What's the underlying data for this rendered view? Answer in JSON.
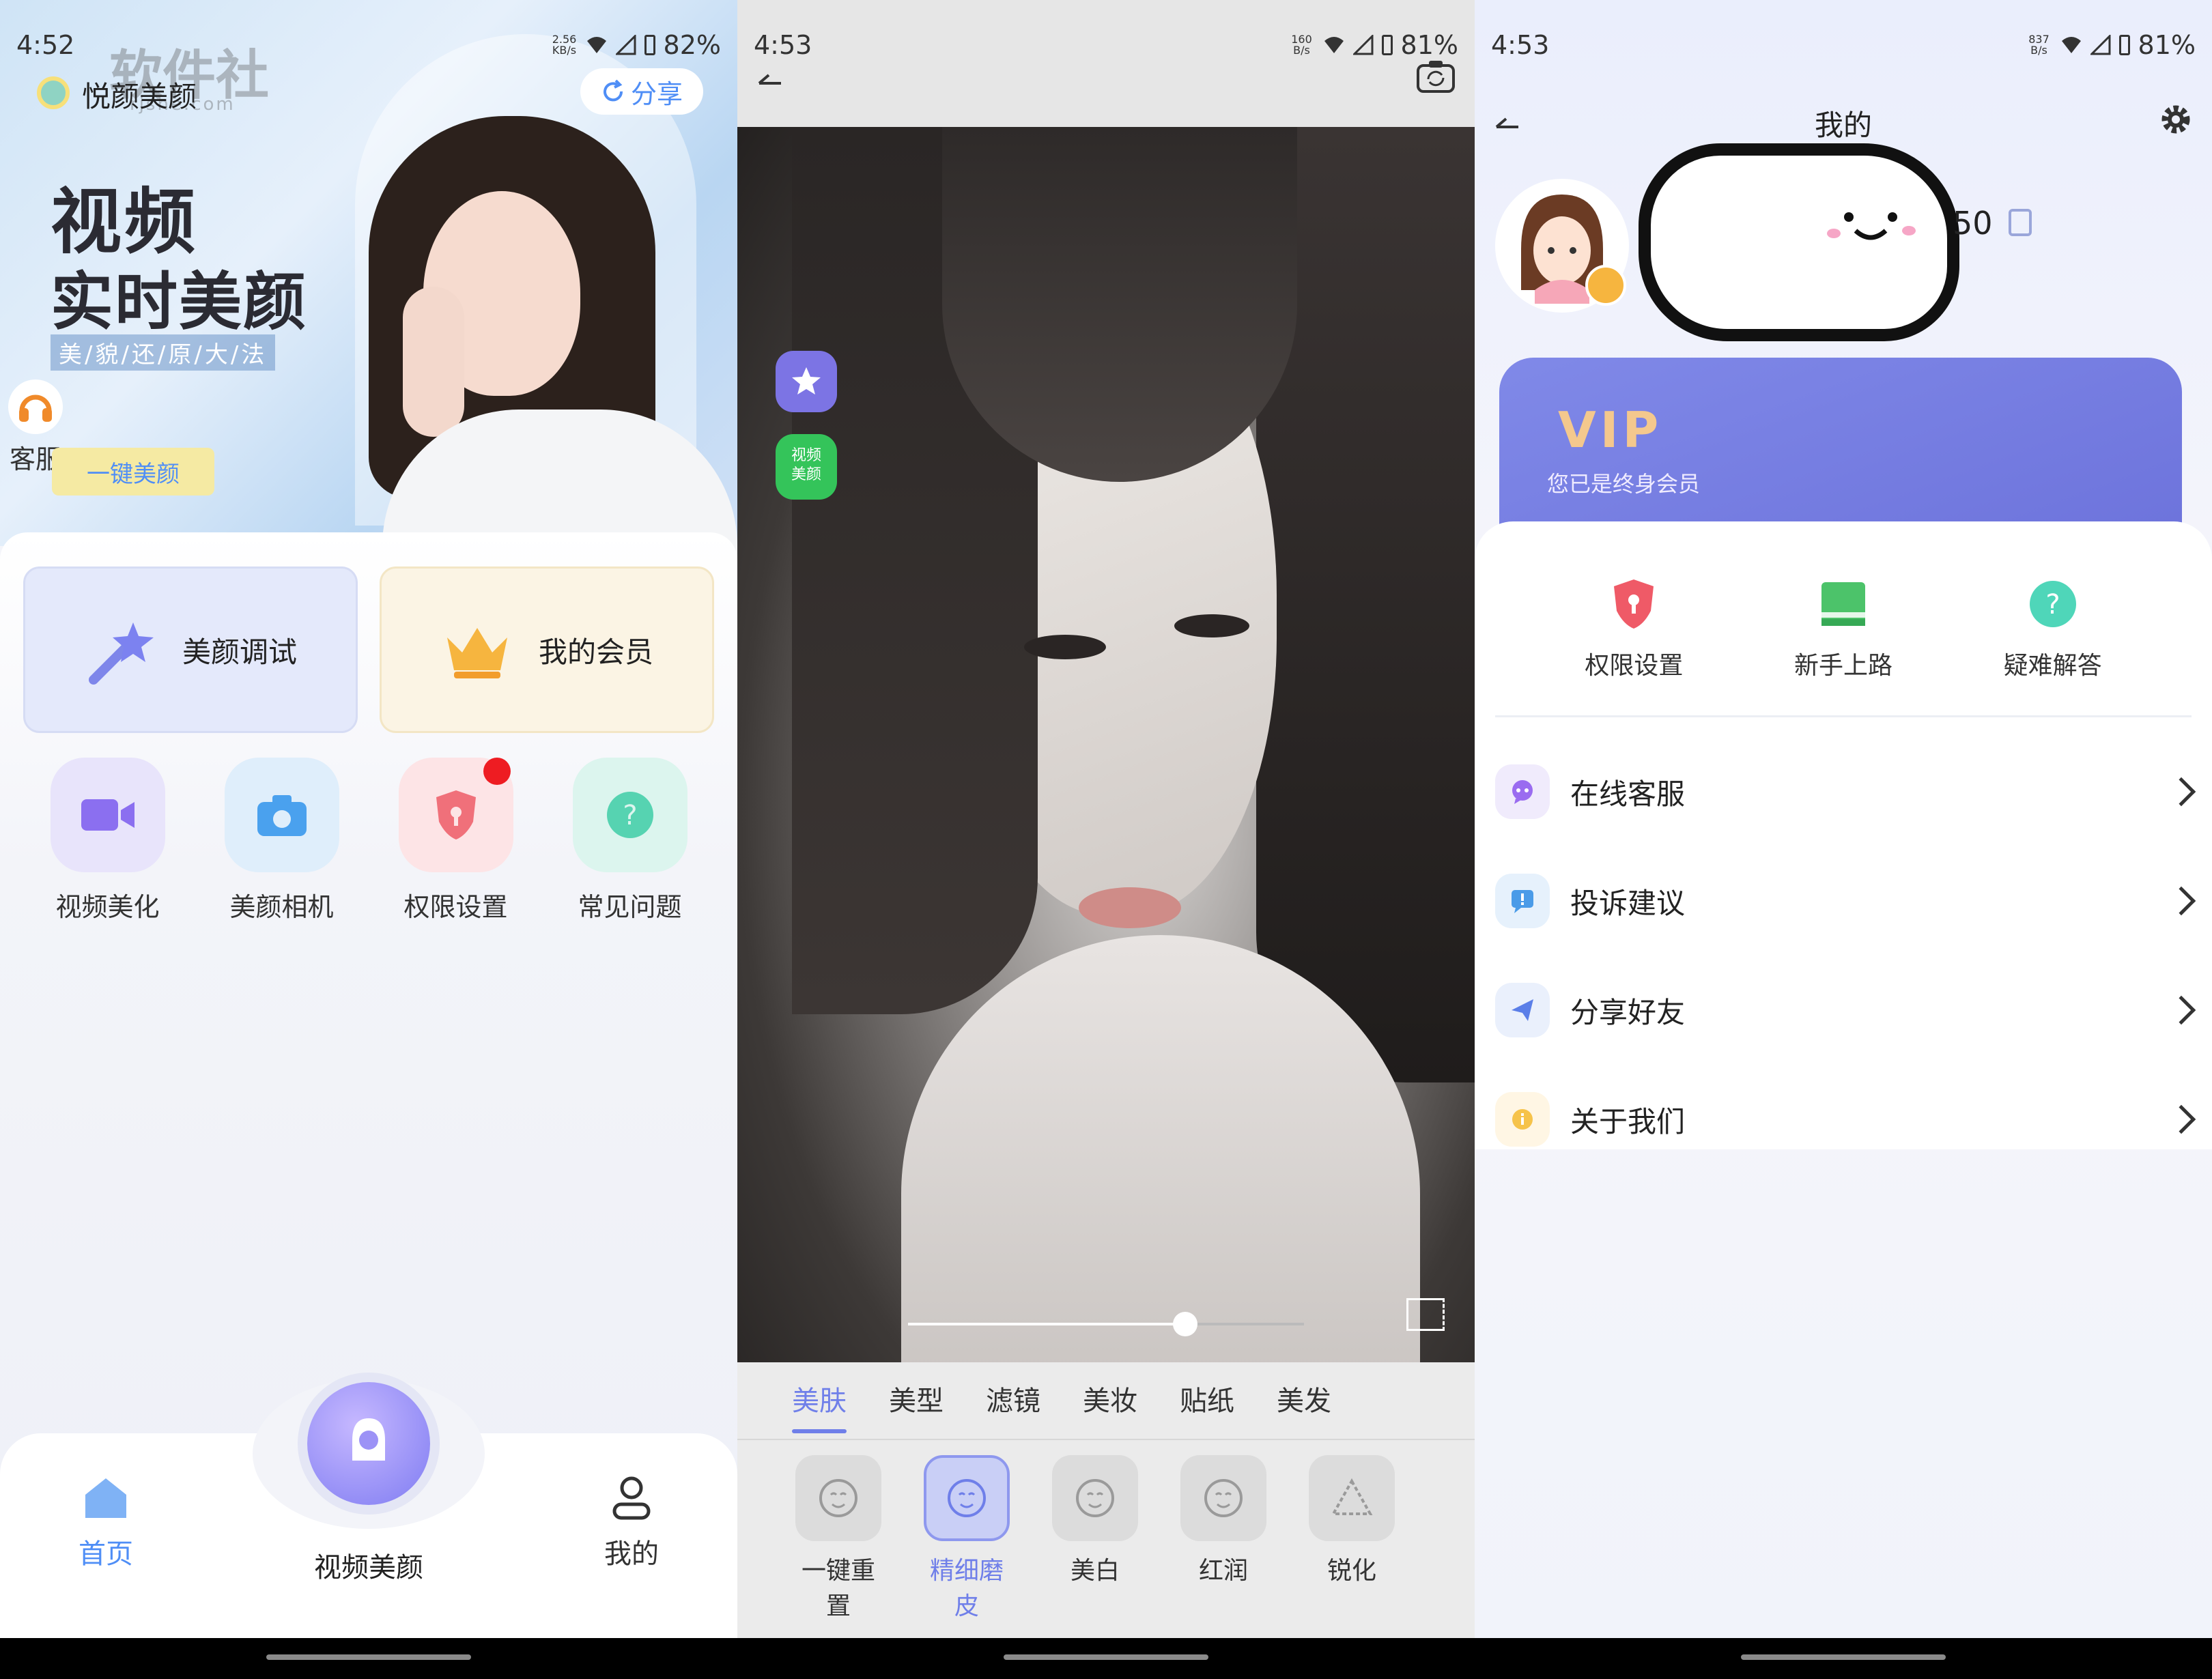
{
  "panel1": {
    "status": {
      "time": "4:52",
      "speed": "2.56 KB/s",
      "battery": "82%"
    },
    "watermark": {
      "text": "软件社",
      "url": "rjshe.com"
    },
    "banner": {
      "app_name": "悦颜美颜",
      "share_label": "分享",
      "title_line1": "视频",
      "title_line2": "实时美颜",
      "subtitle": "美/貌/还/原/大/法",
      "service_label": "客服",
      "onekey_label": "一键美颜"
    },
    "cards": [
      {
        "label": "美颜调试",
        "icon": "magic-wand-icon"
      },
      {
        "label": "我的会员",
        "icon": "crown-icon"
      }
    ],
    "grid": [
      {
        "label": "视频美化",
        "icon": "video-icon",
        "color": "#e8e4fb"
      },
      {
        "label": "美颜相机",
        "icon": "camera-icon",
        "color": "#dfeefb"
      },
      {
        "label": "权限设置",
        "icon": "shield-icon",
        "color": "#fde4e6"
      },
      {
        "label": "常见问题",
        "icon": "question-icon",
        "color": "#dcf5ee"
      }
    ],
    "tabs": {
      "home": "首页",
      "center": "视频美颜",
      "mine": "我的"
    },
    "colors": {
      "accent": "#4f8ef6",
      "badge": "#ee1c22"
    }
  },
  "panel2": {
    "status": {
      "time": "4:53",
      "speed": "160 B/s",
      "battery": "81%"
    },
    "side_label": "视频\n美颜",
    "slider_value": 0.7,
    "tabs": [
      "美肤",
      "美型",
      "滤镜",
      "美妆",
      "贴纸",
      "美发"
    ],
    "active_tab": "美肤",
    "tools": [
      {
        "label": "一键重置",
        "icon": "reset-face-icon",
        "selected": false
      },
      {
        "label": "精细磨皮",
        "icon": "smooth-face-icon",
        "selected": true
      },
      {
        "label": "美白",
        "icon": "whiten-face-icon",
        "selected": false
      },
      {
        "label": "红润",
        "icon": "rosy-face-icon",
        "selected": false
      },
      {
        "label": "锐化",
        "icon": "sharpen-icon",
        "selected": false
      }
    ]
  },
  "panel3": {
    "status": {
      "time": "4:53",
      "speed": "837 B/s",
      "battery": "81%"
    },
    "title": "我的",
    "uid_suffix": "50",
    "vip": {
      "badge": "VIP",
      "status": "您已是终身会员"
    },
    "quick": [
      {
        "label": "权限设置",
        "icon": "shield-icon"
      },
      {
        "label": "新手上路",
        "icon": "book-icon"
      },
      {
        "label": "疑难解答",
        "icon": "question-icon"
      }
    ],
    "list": [
      {
        "label": "在线客服",
        "icon": "chat-icon",
        "color": "#f0ebfc"
      },
      {
        "label": "投诉建议",
        "icon": "feedback-icon",
        "color": "#e6f1fc"
      },
      {
        "label": "分享好友",
        "icon": "send-icon",
        "color": "#eaf0fc"
      },
      {
        "label": "关于我们",
        "icon": "info-icon",
        "color": "#fff6e4"
      }
    ]
  }
}
